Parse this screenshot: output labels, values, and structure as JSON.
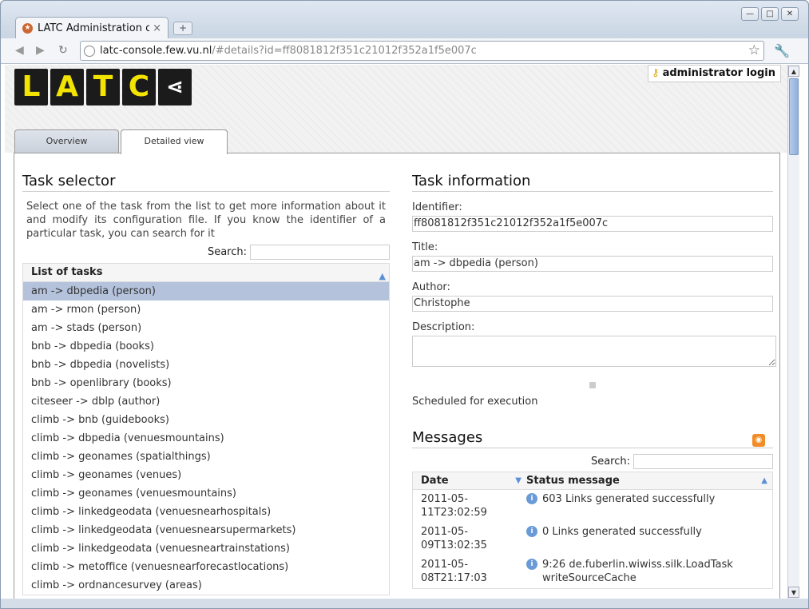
{
  "browser": {
    "tab_title": "LATC Administration co",
    "tab_close": "×",
    "new_tab": "+",
    "url_host": "latc-console.few.vu.nl",
    "url_path": "/#details?id=ff8081812f351c21012f352a1f5e007c"
  },
  "header": {
    "logo_letters": [
      "L",
      "A",
      "T",
      "C"
    ],
    "login_label": "administrator login"
  },
  "tabs": [
    {
      "label": "Overview",
      "active": false
    },
    {
      "label": "Detailed view",
      "active": true
    }
  ],
  "task_selector": {
    "title": "Task selector",
    "description": "Select one of the task from the list to get more information about it and modify its configuration file. If you know the identifier of a particular task, you can search for it",
    "search_label": "Search:",
    "list_header": "List of tasks",
    "tasks": [
      "am -> dbpedia (person)",
      "am -> rmon (person)",
      "am -> stads (person)",
      "bnb -> dbpedia (books)",
      "bnb -> dbpedia (novelists)",
      "bnb -> openlibrary (books)",
      "citeseer -> dblp (author)",
      "climb -> bnb (guidebooks)",
      "climb -> dbpedia (venuesmountains)",
      "climb -> geonames (spatialthings)",
      "climb -> geonames (venues)",
      "climb -> geonames (venuesmountains)",
      "climb -> linkedgeodata (venuesnearhospitals)",
      "climb -> linkedgeodata (venuesnearsupermarkets)",
      "climb -> linkedgeodata (venuesneartrainstations)",
      "climb -> metoffice (venuesnearforecastlocations)",
      "climb -> ordnancesurvey (areas)"
    ],
    "selected_index": 0
  },
  "task_info": {
    "title": "Task information",
    "identifier_label": "Identifier:",
    "identifier": "ff8081812f351c21012f352a1f5e007c",
    "title_label": "Title:",
    "task_title": "am -> dbpedia (person)",
    "author_label": "Author:",
    "author": "Christophe",
    "description_label": "Description:",
    "status": "Scheduled for execution"
  },
  "messages": {
    "title": "Messages",
    "search_label": "Search:",
    "col_date": "Date",
    "col_status": "Status message",
    "rows": [
      {
        "date": "2011-05-11T23:02:59",
        "message": "603 Links generated successfully"
      },
      {
        "date": "2011-05-09T13:02:35",
        "message": "0 Links generated successfully"
      },
      {
        "date": "2011-05-08T21:17:03",
        "message": "9:26 de.fuberlin.wiwiss.silk.LoadTask writeSourceCache"
      }
    ]
  }
}
